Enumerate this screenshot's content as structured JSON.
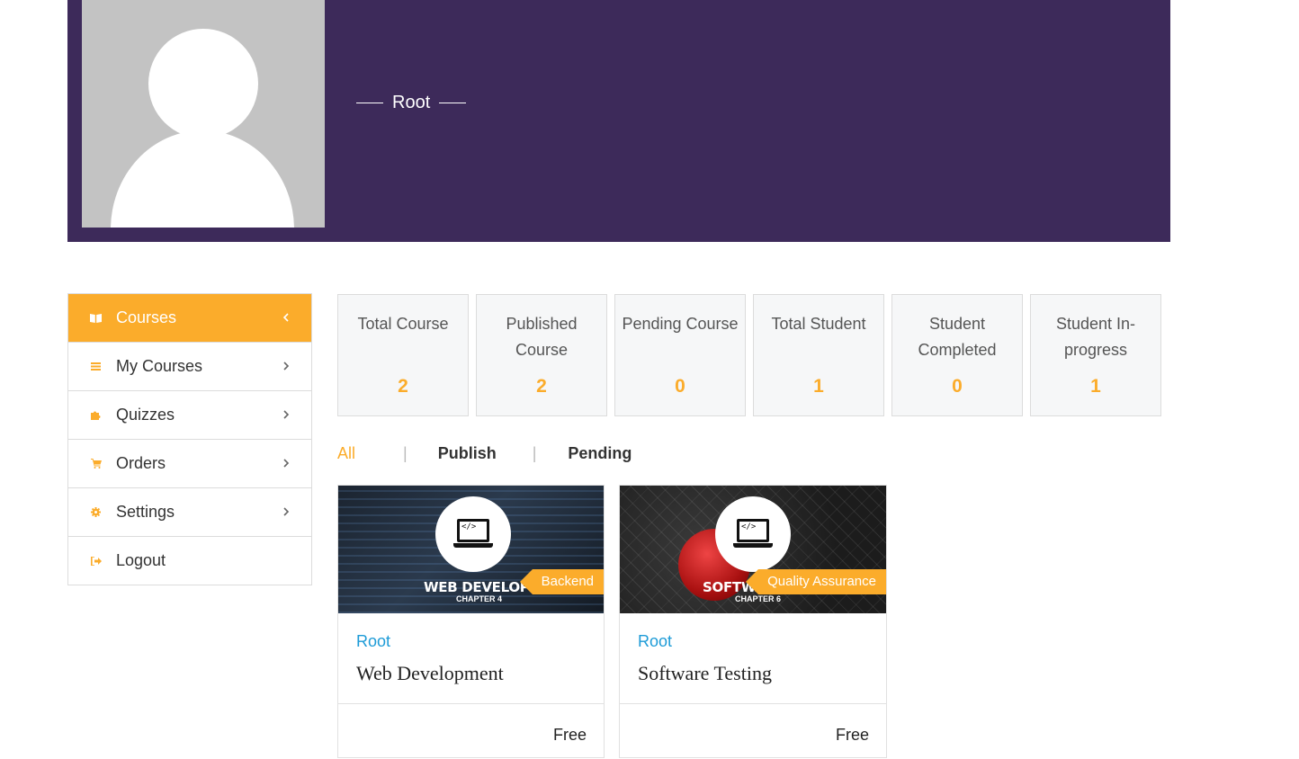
{
  "profile": {
    "username": "Root"
  },
  "sidebar": {
    "items": [
      {
        "label": "Courses",
        "icon": "book-open-icon",
        "active": true
      },
      {
        "label": "My Courses",
        "icon": "list-icon",
        "active": false
      },
      {
        "label": "Quizzes",
        "icon": "puzzle-icon",
        "active": false
      },
      {
        "label": "Orders",
        "icon": "cart-icon",
        "active": false
      },
      {
        "label": "Settings",
        "icon": "gear-icon",
        "active": false
      },
      {
        "label": "Logout",
        "icon": "sign-out-icon",
        "active": false
      }
    ]
  },
  "stats": [
    {
      "label": "Total Course",
      "value": "2"
    },
    {
      "label": "Published Course",
      "value": "2"
    },
    {
      "label": "Pending Course",
      "value": "0"
    },
    {
      "label": "Total Student",
      "value": "1"
    },
    {
      "label": "Student Completed",
      "value": "0"
    },
    {
      "label": "Student In-progress",
      "value": "1"
    }
  ],
  "tabs": {
    "all": "All",
    "separator": "|",
    "publish": "Publish",
    "pending": "Pending"
  },
  "courses": [
    {
      "author": "Root",
      "title": "Web Development",
      "category": "Backend",
      "price": "Free",
      "thumb_banner": "WEB DEVELOPMENT",
      "thumb_chapter": "CHAPTER 4"
    },
    {
      "author": "Root",
      "title": "Software Testing",
      "category": "Quality Assurance",
      "price": "Free",
      "thumb_banner": "SOFTWAR",
      "thumb_chapter": "CHAPTER 6"
    }
  ],
  "colors": {
    "accent": "#fbac2b",
    "header_bg": "#3d2a5a",
    "author_link": "#1d9bd7"
  }
}
